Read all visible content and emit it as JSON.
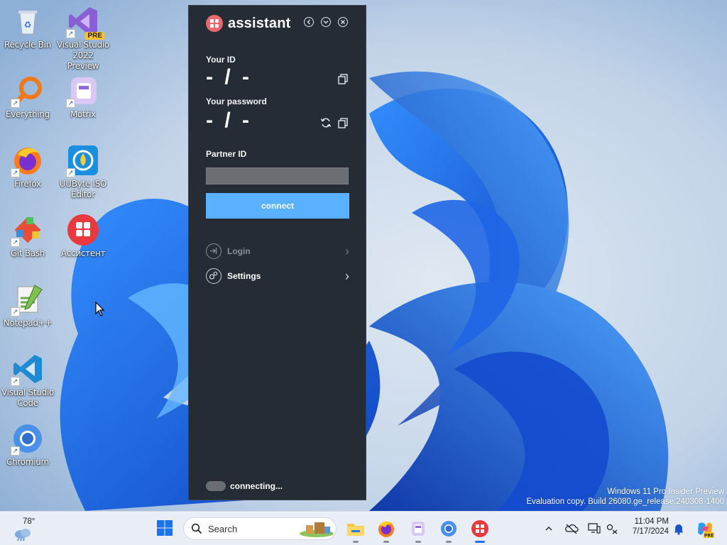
{
  "desktop": {
    "icons": [
      {
        "label": "Recycle Bin"
      },
      {
        "label": "Visual Studio 2022 Preview",
        "badge": "PRE"
      },
      {
        "label": "Everything"
      },
      {
        "label": "Motrix"
      },
      {
        "label": "Firefox"
      },
      {
        "label": "UUByte ISO Editor"
      },
      {
        "label": "Git Bash"
      },
      {
        "label": "Ассистент"
      },
      {
        "label": "Notepad++"
      },
      {
        "label": "Visual Studio Code"
      },
      {
        "label": "Chromium"
      }
    ]
  },
  "assistant": {
    "title": "assistant",
    "your_id_label": "Your ID",
    "your_id_value": "- / -",
    "your_password_label": "Your password",
    "your_password_value": "- / -",
    "partner_id_label": "Partner ID",
    "partner_id_value": "",
    "connect_label": "connect",
    "menu": [
      {
        "label": "Login",
        "enabled": false
      },
      {
        "label": "Settings",
        "enabled": true
      }
    ],
    "status_text": "connecting..."
  },
  "watermark": {
    "line1": "Windows 11 Pro Insider Preview",
    "line2": "Evaluation copy. Build 26080.ge_release.240308-1400"
  },
  "taskbar": {
    "weather_temp": "78°",
    "search_label": "Search",
    "time": "11:04 PM",
    "date": "7/17/2024"
  },
  "colors": {
    "panel_bg": "#262c35",
    "connect_blue": "#59b1ff",
    "brand_red": "#e8696e"
  }
}
